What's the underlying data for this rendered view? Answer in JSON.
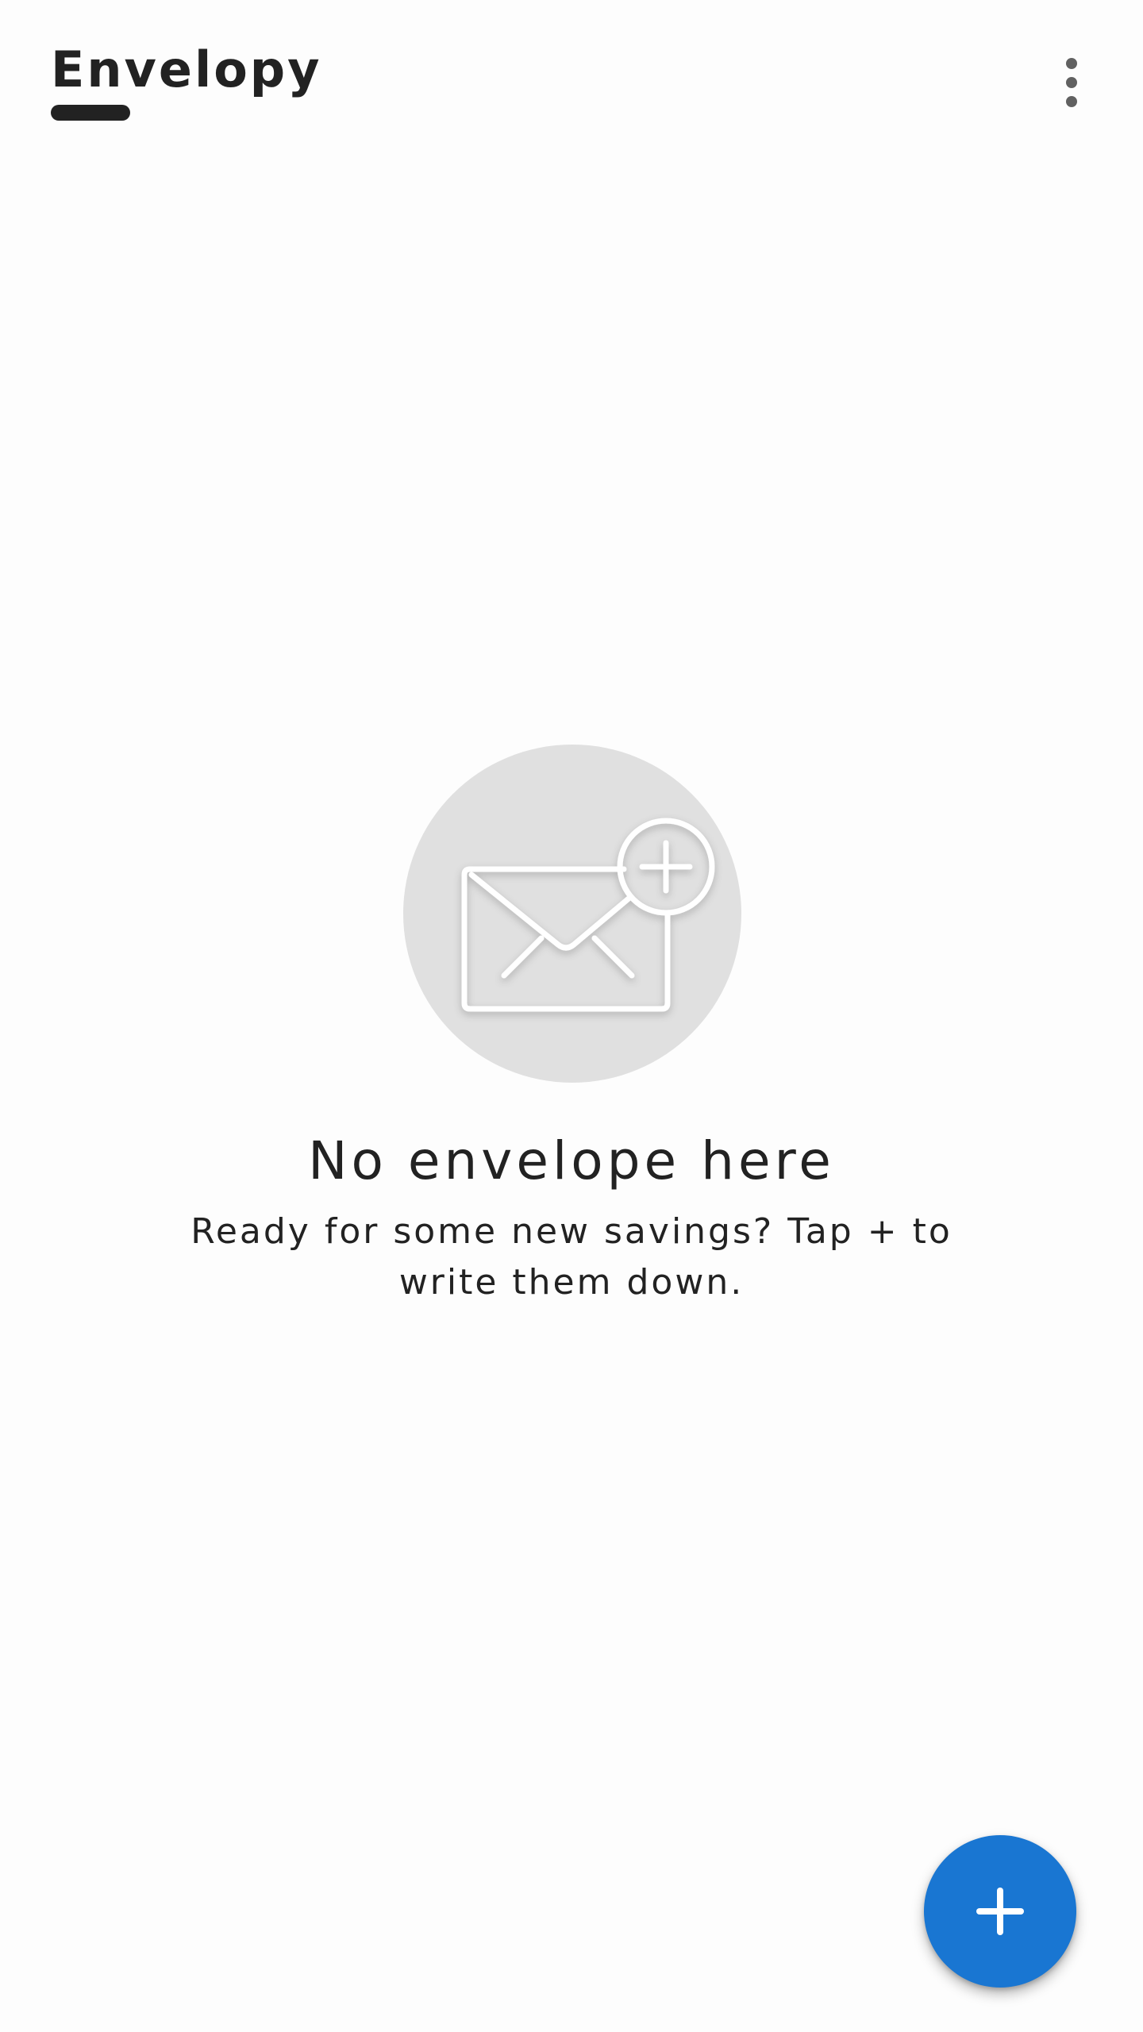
{
  "app_bar": {
    "title": "Envelopy",
    "overflow_icon": "more-vert-icon"
  },
  "empty_state": {
    "illustration_icon": "envelope-add-icon",
    "title": "No envelope here",
    "subtitle": "Ready for some new savings? Tap + to write them down."
  },
  "fab": {
    "icon": "plus-icon"
  },
  "colors": {
    "background": "#fdfdfd",
    "text": "#222222",
    "title_underline": "#222222",
    "menu_dots": "#616161",
    "illustration_circle": "#e0e0e0",
    "illustration_stroke": "#ffffff",
    "fab": "#1976d2",
    "fab_icon": "#ffffff"
  }
}
